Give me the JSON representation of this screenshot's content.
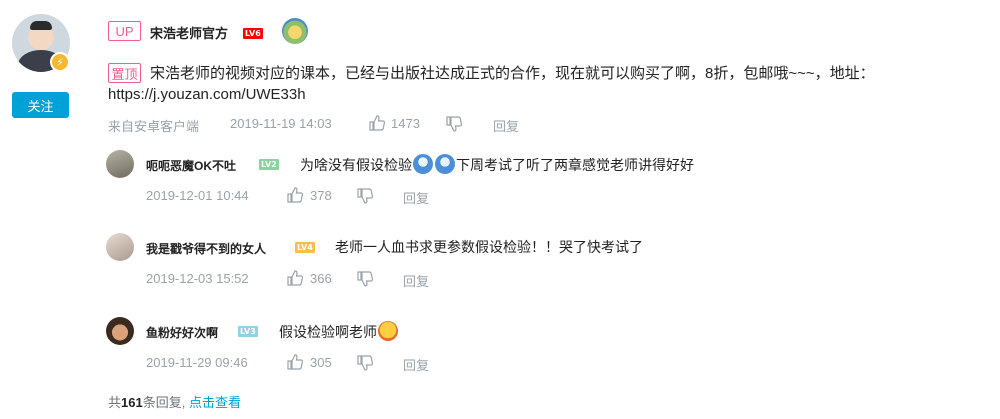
{
  "main": {
    "up_tag": "UP",
    "author": "宋浩老师官方",
    "level": "LV6",
    "follow_label": "关注",
    "pin_tag": "置顶",
    "text_line1": "宋浩老师的视频对应的课本，已经与出版社达成正式的合作，现在就可以购买了啊，8折，包邮哦~~~，地址：",
    "text_line2": "https://j.youzan.com/UWE33h",
    "source": "来自安卓客户端",
    "time": "2019-11-19 14:03",
    "likes": "1473",
    "reply_label": "回复"
  },
  "replies": [
    {
      "name": "呃呃恶魔OK不吐",
      "level": "LV2",
      "text_a": "为啥没有假设检验",
      "text_b": "下周考试了听了两章感觉老师讲得好好",
      "time": "2019-12-01 10:44",
      "likes": "378",
      "reply_label": "回复"
    },
    {
      "name": "我是戳爷得不到的女人",
      "level": "LV4",
      "text": "老师一人血书求更参数假设检验！！哭了快考试了",
      "time": "2019-12-03 15:52",
      "likes": "366",
      "reply_label": "回复"
    },
    {
      "name": "鱼粉好好次啊",
      "level": "LV3",
      "text": "假设检验啊老师",
      "time": "2019-11-29 09:46",
      "likes": "305",
      "reply_label": "回复"
    }
  ],
  "footer": {
    "prefix": "共",
    "count": "161",
    "suffix": "条回复,",
    "link": "点击查看"
  },
  "colors": {
    "accent": "#00a1d6",
    "up_pink": "#f25d8e",
    "meta_gray": "#99a2aa"
  }
}
